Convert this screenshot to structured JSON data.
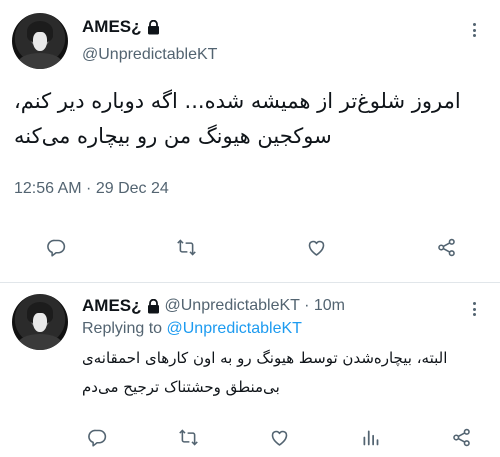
{
  "main_tweet": {
    "display_name": "AMES¿",
    "handle": "@UnpredictableKT",
    "text_lines": [
      "امروز شلوغ‌تر از همیشه شده... اگه دوباره دیر کنم،",
      "سوکجین هیونگ من رو بیچاره می‌کنه"
    ],
    "timestamp": "12:56 AM · 29 Dec 24",
    "icons": [
      "lock-icon",
      "more-icon",
      "reply-icon",
      "retweet-icon",
      "like-icon",
      "share-icon"
    ]
  },
  "reply_tweet": {
    "display_name": "AMES¿",
    "handle_time": "@UnpredictableKT · 10m",
    "replying_prefix": "Replying to",
    "replying_handle": "@UnpredictableKT",
    "text_lines": [
      "البته، بیچاره‌شدن توسط هیونگ رو به اون کارهای احمقانه‌ی",
      "بی‌منطق وحشتناک ترجیح می‌دم"
    ],
    "icons": [
      "lock-icon",
      "more-icon",
      "reply-icon",
      "retweet-icon",
      "like-icon",
      "views-icon",
      "share-icon"
    ]
  },
  "colors": {
    "text": "#0f1419",
    "secondary": "#536471",
    "link": "#1d9bf0",
    "divider": "#e1e6ea"
  }
}
